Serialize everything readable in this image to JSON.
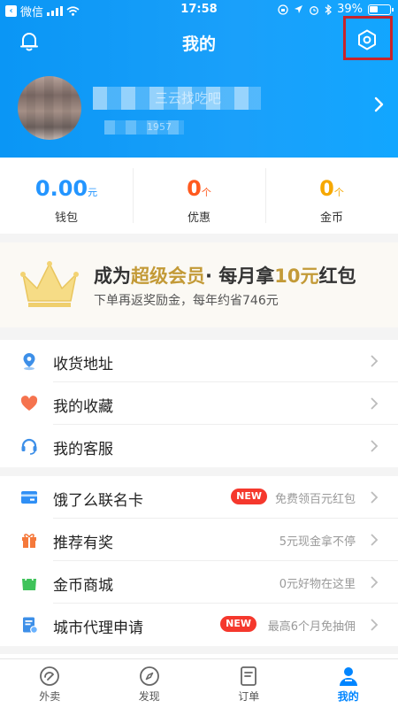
{
  "status_bar": {
    "back_app": "微信",
    "time": "17:58",
    "battery": "39%"
  },
  "header": {
    "title": "我的"
  },
  "profile": {
    "name": "三云找吃吧",
    "phone": "1957"
  },
  "stats": [
    {
      "value": "0.00",
      "unit": "元",
      "label": "钱包",
      "color": "#2395ff"
    },
    {
      "value": "0",
      "unit": "个",
      "label": "优惠",
      "color": "#ff5a1f"
    },
    {
      "value": "0",
      "unit": "个",
      "label": "金币",
      "color": "#f6a800"
    }
  ],
  "vip": {
    "title_prefix": "成为",
    "title_highlight": "超级会员",
    "title_mid": "· 每月拿",
    "title_amount": "10元",
    "title_suffix": "红包",
    "subtitle": "下单再返奖励金，每年约省746元"
  },
  "menu_group_1": [
    {
      "label": "收货地址",
      "icon": "location-pin-icon"
    },
    {
      "label": "我的收藏",
      "icon": "heart-icon"
    },
    {
      "label": "我的客服",
      "icon": "headset-icon"
    }
  ],
  "menu_group_2": [
    {
      "label": "饿了么联名卡",
      "icon": "card-icon",
      "badge": "NEW",
      "hint": "免费领百元红包"
    },
    {
      "label": "推荐有奖",
      "icon": "gift-icon",
      "hint": "5元现金拿不停"
    },
    {
      "label": "金币商城",
      "icon": "shopping-bag-icon",
      "hint": "0元好物在这里"
    },
    {
      "label": "城市代理申请",
      "icon": "document-icon",
      "badge": "NEW",
      "hint": "最高6个月免抽佣"
    }
  ],
  "tabs": [
    {
      "label": "外卖",
      "icon": "takeout-icon"
    },
    {
      "label": "发现",
      "icon": "compass-icon"
    },
    {
      "label": "订单",
      "icon": "order-icon"
    },
    {
      "label": "我的",
      "icon": "profile-icon"
    }
  ],
  "colors": {
    "primary": "#1aa0fa",
    "accent_red": "#f5382d",
    "highlight_box": "#c8242a"
  }
}
